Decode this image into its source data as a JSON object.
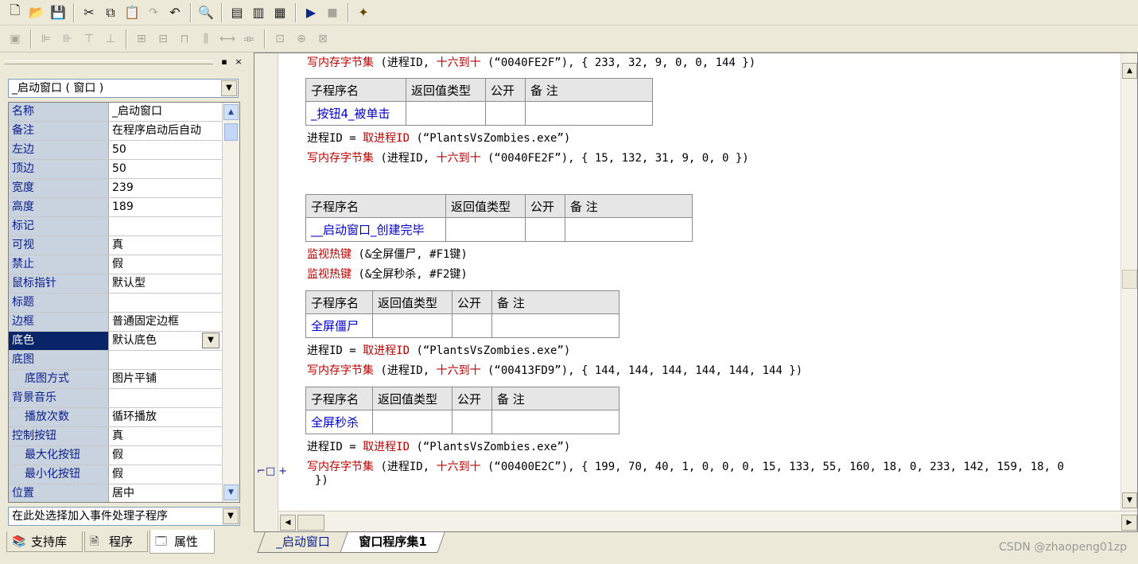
{
  "toolbar1": {
    "icons": [
      "new-file-icon",
      "open-folder-icon",
      "save-icon",
      "cut-icon",
      "copy-icon",
      "paste-icon",
      "redo-icon",
      "undo-icon",
      "find-icon",
      "layout1-icon",
      "layout2-icon",
      "layout3-icon",
      "run-icon",
      "stop-icon",
      "wizard-icon"
    ]
  },
  "toolbar2": {
    "icons": [
      "align-icon",
      "align-left-icon",
      "align-right-icon",
      "align-top-icon",
      "align-bottom-icon",
      "center-h-icon",
      "center-v-icon",
      "same-width-icon",
      "same-height-icon",
      "space-h-icon",
      "space-v-icon",
      "size-icon",
      "grid-icon",
      "tab-order-icon"
    ]
  },
  "left_panel": {
    "header_buttons": [
      "▪",
      "×"
    ],
    "object_select": "_启动窗口 ( 窗口 )",
    "properties": [
      {
        "name": "名称",
        "value": "_启动窗口"
      },
      {
        "name": "备注",
        "value": "在程序启动后自动"
      },
      {
        "name": "左边",
        "value": "50"
      },
      {
        "name": "顶边",
        "value": "50"
      },
      {
        "name": "宽度",
        "value": "239"
      },
      {
        "name": "高度",
        "value": "189"
      },
      {
        "name": "标记",
        "value": ""
      },
      {
        "name": "可视",
        "value": "真"
      },
      {
        "name": "禁止",
        "value": "假"
      },
      {
        "name": "鼠标指针",
        "value": "默认型"
      },
      {
        "name": "标题",
        "value": ""
      },
      {
        "name": "边框",
        "value": "普通固定边框"
      },
      {
        "name": "底色",
        "value": "默认底色"
      },
      {
        "name": "底图",
        "value": ""
      },
      {
        "name": "底图方式",
        "value": "图片平铺"
      },
      {
        "name": "背景音乐",
        "value": ""
      },
      {
        "name": "播放次数",
        "value": "循环播放"
      },
      {
        "name": "控制按钮",
        "value": "真"
      },
      {
        "name": "最大化按钮",
        "value": "假"
      },
      {
        "name": "最小化按钮",
        "value": "假"
      },
      {
        "name": "位置",
        "value": "居中"
      }
    ],
    "event_select": "在此处选择加入事件处理子程序",
    "tabs": [
      {
        "label": "支持库"
      },
      {
        "label": "程序"
      },
      {
        "label": "属性"
      }
    ]
  },
  "editor": {
    "line1": {
      "cmd": "写内存字节集",
      "args": " (进程ID, ",
      "fn": "十六到十",
      "rest": " (“0040FE2F”), { 233, 32, 9, 0, 0, 144 })"
    },
    "table_headers": [
      "子程序名",
      "返回值类型",
      "公开",
      "备 注"
    ],
    "sub1": {
      "name": "_按钮4_被单击"
    },
    "line2": {
      "var": "进程ID = ",
      "fn": "取进程ID",
      "rest": " (“PlantsVsZombies.exe”)"
    },
    "line3": {
      "cmd": "写内存字节集",
      "args": " (进程ID, ",
      "fn": "十六到十",
      "rest": " (“0040FE2F”), { 15, 132, 31, 9, 0, 0 })"
    },
    "sub2": {
      "name": "__启动窗口_创建完毕"
    },
    "line4": {
      "cmd": "监视热键",
      "rest": " (&全屏僵尸, #F1键)"
    },
    "line5": {
      "cmd": "监视热键",
      "rest": " (&全屏秒杀, #F2键)"
    },
    "sub3": {
      "name": "全屏僵尸"
    },
    "line6": {
      "var": "进程ID = ",
      "fn": "取进程ID",
      "rest": " (“PlantsVsZombies.exe”)"
    },
    "line7": {
      "cmd": "写内存字节集",
      "args": " (进程ID, ",
      "fn": "十六到十",
      "rest": " (“00413FD9”), { 144, 144, 144, 144, 144, 144 })"
    },
    "sub4": {
      "name": "全屏秒杀"
    },
    "line8": {
      "var": "进程ID = ",
      "fn": "取进程ID",
      "rest": " (“PlantsVsZombies.exe”)"
    },
    "line9": {
      "cmd": "写内存字节集",
      "args": " (进程ID, ",
      "fn": "十六到十",
      "rest": " (“00400E2C”), { 199, 70, 40, 1, 0, 0, 0, 15, 133, 55, 160, 18, 0, 233, 142, 159, 18, 0"
    },
    "line10": {
      "rest": "})"
    },
    "fold_marker": "⌐□ +"
  },
  "bottom_tabs": [
    {
      "label": "_启动窗口"
    },
    {
      "label": "窗口程序集1"
    }
  ],
  "watermark": "CSDN @zhaopeng01zp"
}
